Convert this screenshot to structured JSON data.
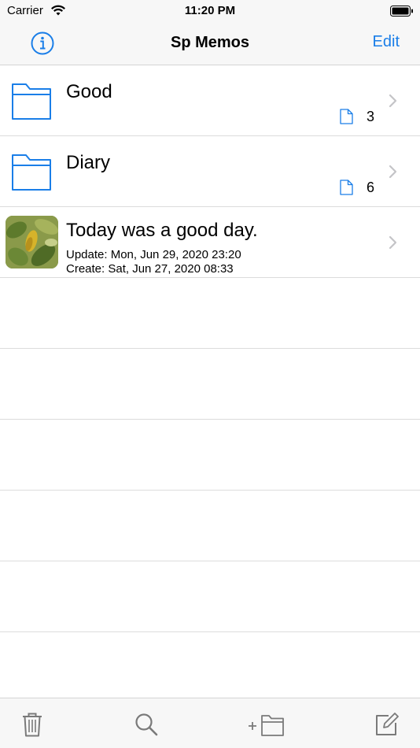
{
  "status_bar": {
    "carrier": "Carrier",
    "time": "11:20 PM"
  },
  "nav": {
    "title": "Sp Memos",
    "edit_label": "Edit",
    "info_icon": "info-circle-icon"
  },
  "folders": [
    {
      "name": "Good",
      "count": "3"
    },
    {
      "name": "Diary",
      "count": "6"
    }
  ],
  "memo": {
    "title": "Today was a good day.",
    "update": "Update: Mon, Jun 29, 2020 23:20",
    "create": "Create: Sat, Jun 27, 2020 08:33"
  },
  "toolbar": {
    "items": [
      "trash-icon",
      "search-icon",
      "add-folder-icon",
      "compose-icon"
    ]
  },
  "colors": {
    "accent": "#1a7ee8",
    "toolbar_icon": "#7a7a7a",
    "separator": "#dcdcdc"
  }
}
